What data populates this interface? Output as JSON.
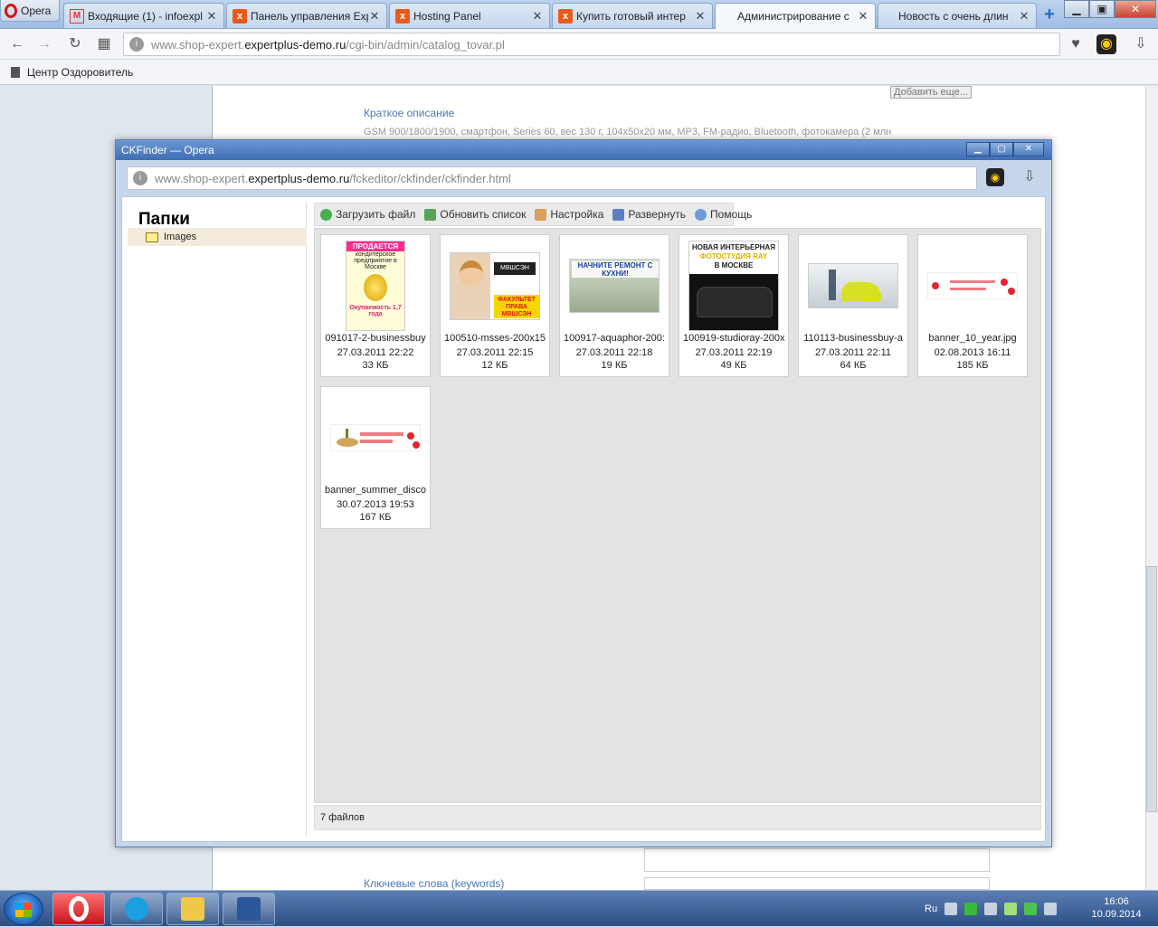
{
  "browser": {
    "menu_label": "Opera",
    "tabs": [
      {
        "title": "Входящие (1) - infoexpl",
        "icon": "gmail-icon"
      },
      {
        "title": "Панель управления Exp",
        "icon": "expert-icon"
      },
      {
        "title": "Hosting Panel",
        "icon": "expert-icon"
      },
      {
        "title": "Купить готовый интер",
        "icon": "expert-icon"
      },
      {
        "title": "Администрирование с",
        "icon": "none",
        "active": true
      },
      {
        "title": "Новость с очень длин",
        "icon": "none"
      }
    ],
    "new_tab": "+",
    "url_prefix": "www.shop-expert.",
    "url_domain": "expertplus-demo.ru",
    "url_path": "/cgi-bin/admin/catalog_tovar.pl",
    "bookmark": "Центр Оздоровитель"
  },
  "background_page": {
    "short_description_label": "Краткое описание",
    "short_description_text": "GSM 900/1800/1900, смартфон, Series 60, вес 130 г, 104x50x20 мм, MP3, FM-радио, Bluetooth, фотокамера (2 млн",
    "add_more_button": "Добавить еще...",
    "keywords_label": "Ключевые слова (keywords)"
  },
  "popup": {
    "title": "CKFinder — Opera",
    "url_prefix": "www.shop-expert.",
    "url_domain": "expertplus-demo.ru",
    "url_path": "/fckeditor/ckfinder/ckfinder.html",
    "folders_title": "Папки",
    "folder": "Images",
    "toolbar": {
      "upload": "Загрузить файл",
      "refresh": "Обновить список",
      "settings": "Настройка",
      "maximize": "Развернуть",
      "help": "Помощь"
    },
    "files": [
      {
        "name": "091017-2-businessbuy",
        "date": "27.03.2011 22:22",
        "size": "33 КБ",
        "thumb": {
          "l1": "ПРОДАЕТСЯ",
          "l2": "кондитерское предприятие в Москве",
          "l3": "Окупаемость 1,7 года"
        }
      },
      {
        "name": "100510-msses-200x15",
        "date": "27.03.2011 22:15",
        "size": "12 КБ",
        "thumb": {
          "l1": "МВШСЭН",
          "l2": "ФАКУЛЬТЕТ ПРАВА МВШСЭН"
        }
      },
      {
        "name": "100917-aquaphor-200:",
        "date": "27.03.2011 22:18",
        "size": "19 КБ",
        "thumb": {
          "l1": "НАЧНИТЕ РЕМОНТ С КУХНИ!"
        }
      },
      {
        "name": "100919-studioray-200x",
        "date": "27.03.2011 22:19",
        "size": "49 КБ",
        "thumb": {
          "l1": "НОВАЯ ИНТЕРЬЕРНАЯ",
          "l2": "ФОТОСТУДИЯ RAY",
          "l3": "В МОСКВЕ"
        }
      },
      {
        "name": "110113-businessbuy-a",
        "date": "27.03.2011 22:11",
        "size": "64 КБ"
      },
      {
        "name": "banner_10_year.jpg",
        "date": "02.08.2013 16:11",
        "size": "185 КБ"
      },
      {
        "name": "banner_summer_disco",
        "date": "30.07.2013 19:53",
        "size": "167 КБ"
      }
    ],
    "status": "7 файлов"
  },
  "taskbar": {
    "lang": "Ru",
    "time": "16:06",
    "date": "10.09.2014"
  },
  "colors": {
    "accent": "#3f6db2",
    "folder_selected": "#f5ebdb",
    "opera_red": "#d6141b"
  }
}
